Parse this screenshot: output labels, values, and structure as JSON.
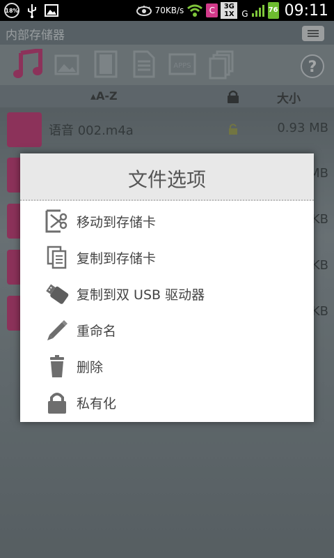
{
  "statusbar": {
    "battery_percent": "18%",
    "net_speed": "70KB/s",
    "app_badge": "C",
    "network_3g_top": "3G",
    "network_3g_bottom": "1X",
    "network_g": "G",
    "battery_level": "76",
    "time": "09:11"
  },
  "header": {
    "title": "内部存储器"
  },
  "category_bar": {
    "icons": [
      "music-icon",
      "image-icon",
      "video-icon",
      "document-icon",
      "apps-icon",
      "files-icon",
      "help-icon"
    ],
    "apps_label": "APPS",
    "help_label": "?"
  },
  "sort_bar": {
    "name_label": "A-Z",
    "size_label": "大小"
  },
  "file_list": [
    {
      "name": "语音 002.m4a",
      "size": "0.93 MB"
    },
    {
      "name": "",
      "size": "MB"
    },
    {
      "name": "",
      "size": "KB"
    },
    {
      "name": "",
      "size": "KB"
    },
    {
      "name": "",
      "size": "KB"
    }
  ],
  "dialog": {
    "title": "文件选项",
    "options": [
      {
        "label": "移动到存储卡",
        "icon": "move-to-card-icon"
      },
      {
        "label": "复制到存储卡",
        "icon": "copy-to-card-icon"
      },
      {
        "label": "复制到双 USB 驱动器",
        "icon": "usb-drive-icon"
      },
      {
        "label": "重命名",
        "icon": "rename-pencil-icon"
      },
      {
        "label": "删除",
        "icon": "trash-icon"
      },
      {
        "label": "私有化",
        "icon": "lock-icon"
      }
    ]
  },
  "colors": {
    "accent": "#c2336f",
    "dialog_header": "#e8e8e8",
    "icon_gray": "#6e6e6e"
  }
}
